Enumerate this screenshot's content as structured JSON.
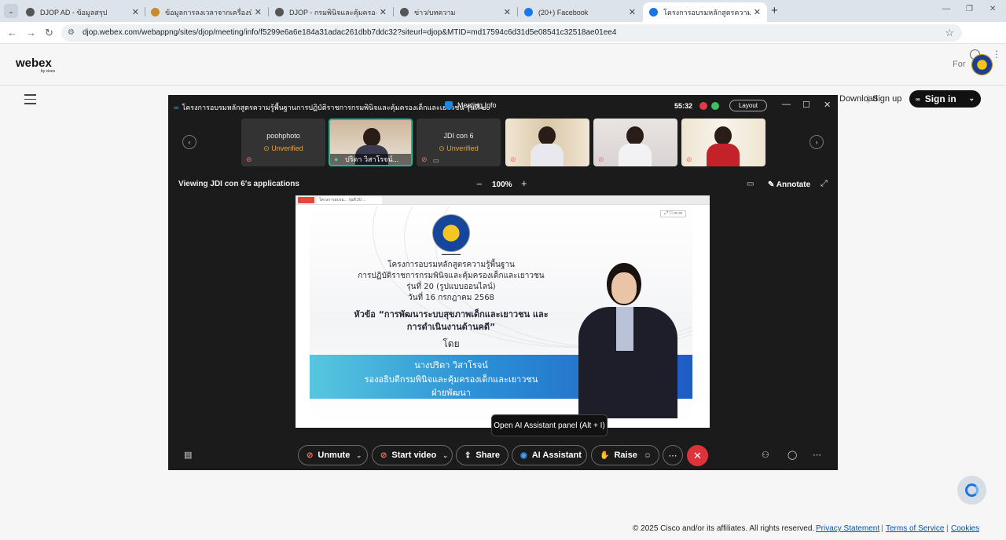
{
  "browser": {
    "tabs": [
      {
        "label": "DJOP AD - ข้อมูลสรุป",
        "favicon_color": "#555555"
      },
      {
        "label": "ข้อมูลการลงเวลาจากเครื่องบันทึกเวลา",
        "favicon_color": "#c98b2a"
      },
      {
        "label": "DJOP - กรมพินิจและคุ้มครองเด็กและ...",
        "favicon_color": "#555555"
      },
      {
        "label": "ข่าว/บทความ",
        "favicon_color": "#555555"
      },
      {
        "label": "(20+) Facebook",
        "favicon_color": "#1877f2"
      },
      {
        "label": "โครงการอบรมหลักสูตรความรู้พื้นฐาน...",
        "favicon_color": "#1a73e8"
      }
    ],
    "new_tab": "+",
    "url": "djop.webex.com/webappng/sites/djop/meeting/info/f5299e6a6e184a31adac261dbb7ddc32?siteurl=djop&MTID=md17594c6d31d5e08541c32518ae01ee4"
  },
  "webex": {
    "logo": "webex",
    "logo_sub": "by cisco",
    "for_label": "For",
    "download": "Download",
    "sign_up": "Sign up",
    "sign_in": "Sign in",
    "footer": {
      "copyright": "© 2025 Cisco and/or its affiliates. All rights reserved.",
      "privacy": "Privacy Statement",
      "terms": "Terms of Service",
      "cookies": "Cookies"
    }
  },
  "meeting": {
    "title": "โครงการอบรมหลักสูตรความรู้พื้นฐานการปฏิบัติราชการกรมพินิจและคุ้มครองเด็กและเยาวชน รุ่นที่ ๒๐",
    "meeting_info": "Meeting Info",
    "timer": "55:32",
    "layout": "Layout",
    "participants": [
      {
        "name": "poohphoto",
        "status": "Unverified"
      },
      {
        "name": "ปริดา วิสาโรจน์...",
        "status": ""
      },
      {
        "name": "JDI con 6",
        "status": "Unverified"
      }
    ],
    "viewing": "Viewing JDI con 6's applications",
    "zoom": "100%",
    "annotate": "Annotate",
    "tooltip": "Open AI Assistant panel (Alt + I)",
    "controls": {
      "unmute": "Unmute",
      "start_video": "Start video",
      "share": "Share",
      "ai_assistant": "AI Assistant",
      "raise": "Raise"
    }
  },
  "slide": {
    "browser_tab": "โครงการอบรม... รุ่นที่ 20 ...",
    "line1": "โครงการอบรมหลักสูตรความรู้พื้นฐาน",
    "line2": "การปฏิบัติราชการกรมพินิจและคุ้มครองเด็กและเยาวชน",
    "line3": "รุ่นที่ 20 (รูปแบบออนไลน์)",
    "line4": "วันที่ 16 กรกฎาคม 2568",
    "topic1": "หัวข้อ “การพัฒนาระบบสุขภาพเด็กและเยาวชน และ",
    "topic2": "การดำเนินงานด้านคดี”",
    "by": "โดย",
    "speaker": "นางปริดา วิสาโรจน์",
    "position1": "รองอธิบดีกรมพินิจและคุ้มครองเด็กและเยาวชน",
    "position2": "ฝ่ายพัฒนา"
  }
}
